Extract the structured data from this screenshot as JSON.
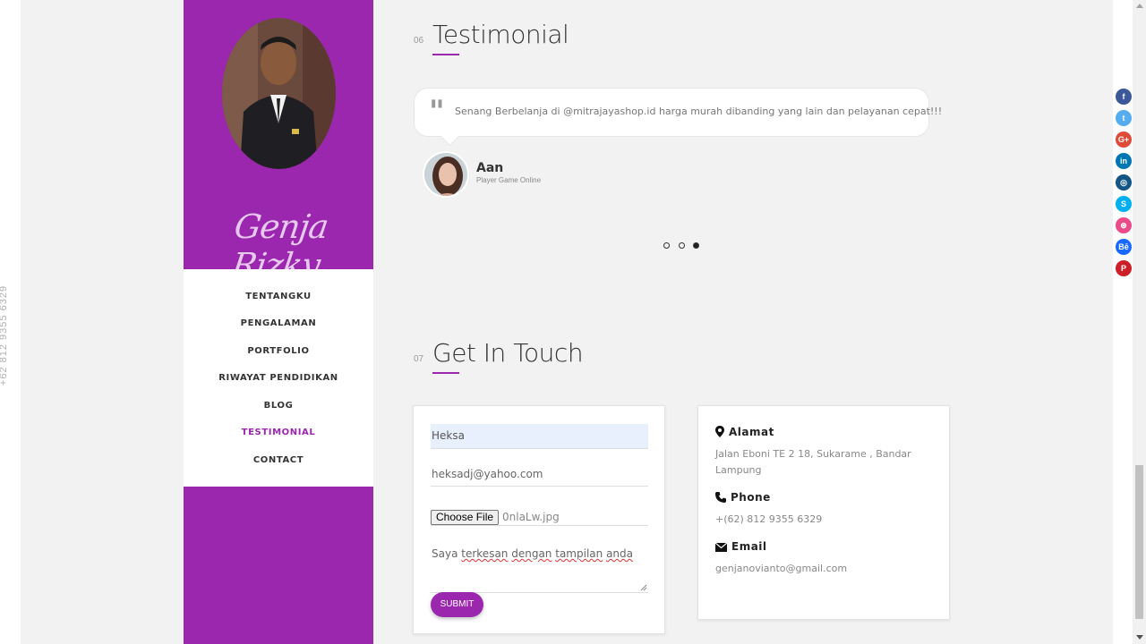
{
  "side_phone": "+62 812 9355 6329",
  "profile": {
    "signature": "Genja Rizky"
  },
  "nav": {
    "items": [
      "TENTANGKU",
      "PENGALAMAN",
      "PORTFOLIO",
      "RIWAYAT PENDIDIKAN",
      "BLOG",
      "TESTIMONIAL",
      "CONTACT"
    ],
    "active": "TESTIMONIAL"
  },
  "testimonial_section": {
    "number": "06",
    "title": "Testimonial",
    "quote_mark": "\"",
    "quote": "Senang Berbelanja di @mitrajayashop.id harga murah dibanding yang lain dan pelayanan cepat!!!",
    "author": "Aan",
    "role": "Player Game Online",
    "slides": 3,
    "active_slide": 3
  },
  "contact_section": {
    "number": "07",
    "title": "Get In Touch",
    "form": {
      "name_value": "Heksa",
      "email_value": "heksadj@yahoo.com",
      "file_button": "Choose File",
      "file_name": "0nlaLw.jpg",
      "message_words": [
        "Saya",
        "terkesan",
        "dengan",
        "tampilan",
        "anda"
      ],
      "submit_label": "SUBMIT"
    },
    "info": {
      "address_label": "Alamat",
      "address": "Jalan Eboni TE 2 18, Sukarame , Bandar Lampung",
      "phone_label": "Phone",
      "phone": "+(62) 812 9355 6329",
      "email_label": "Email",
      "email": "genjanovianto@gmail.com"
    }
  },
  "social": [
    {
      "icon": "facebook-icon",
      "glyph": "f",
      "color": "#3b5998"
    },
    {
      "icon": "twitter-icon",
      "glyph": "t",
      "color": "#55acee"
    },
    {
      "icon": "google-plus-icon",
      "glyph": "G+",
      "color": "#dd4b39"
    },
    {
      "icon": "linkedin-icon",
      "glyph": "in",
      "color": "#0077b5"
    },
    {
      "icon": "instagram-icon",
      "glyph": "◎",
      "color": "#125688"
    },
    {
      "icon": "skype-icon",
      "glyph": "S",
      "color": "#00aff0"
    },
    {
      "icon": "dribbble-icon",
      "glyph": "⊛",
      "color": "#ea4c89"
    },
    {
      "icon": "behance-icon",
      "glyph": "Bē",
      "color": "#1769ff"
    },
    {
      "icon": "pinterest-icon",
      "glyph": "P",
      "color": "#cb2027"
    }
  ],
  "colors": {
    "accent": "#9b27af"
  }
}
